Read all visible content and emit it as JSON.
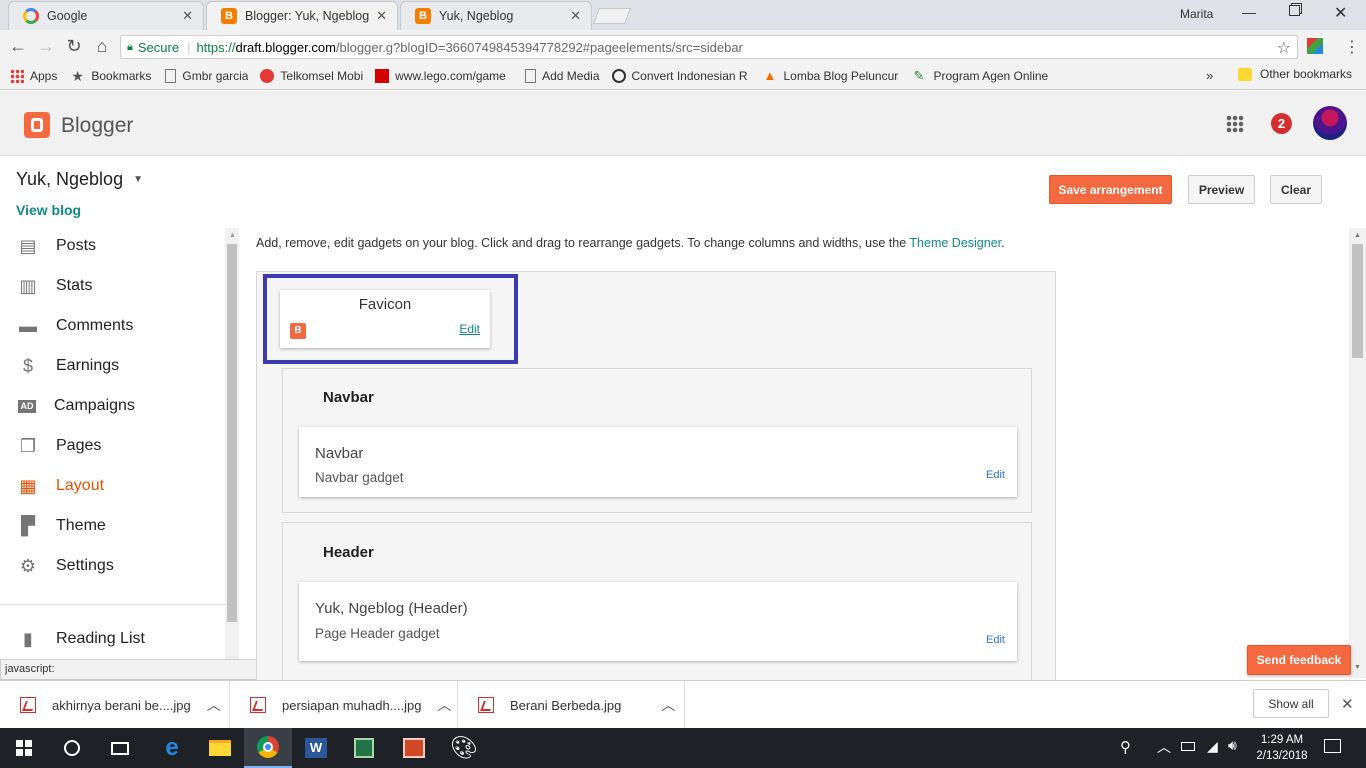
{
  "browser": {
    "tabs": [
      {
        "title": "Google",
        "icon": "google-icon"
      },
      {
        "title": "Blogger: Yuk, Ngeblog - l",
        "icon": "blogger-icon"
      },
      {
        "title": "Yuk, Ngeblog",
        "icon": "blogger-icon"
      }
    ],
    "user": "Marita",
    "secure_label": "Secure",
    "url_prefix": "https://",
    "url_domain": "draft.blogger.com",
    "url_path": "/blogger.g?blogID=3660749845394778292#pageelements/src=sidebar",
    "bookmarks": [
      "Apps",
      "Bookmarks",
      "Gmbr garcia",
      "Telkomsel Mobi",
      "www.lego.com/game",
      "Add Media",
      "Convert Indonesian R",
      "Lomba Blog Peluncur",
      "Program Agen Online"
    ],
    "bookmarks_overflow": "»",
    "other_bookmarks": "Other bookmarks",
    "status_text": "javascript:"
  },
  "blogger": {
    "logo_text": "Blogger",
    "notification_count": "2",
    "blog_name": "Yuk, Ngeblog",
    "view_blog": "View blog",
    "nav": [
      "Posts",
      "Stats",
      "Comments",
      "Earnings",
      "Campaigns",
      "Pages",
      "Layout",
      "Theme",
      "Settings"
    ],
    "reading_list": "Reading List",
    "buttons": {
      "save": "Save arrangement",
      "preview": "Preview",
      "clear": "Clear"
    },
    "instructions": "Add, remove, edit gadgets on your blog. Click and drag to rearrange gadgets. To change columns and widths, use the ",
    "theme_designer_link": "Theme Designer",
    "instructions_end": ".",
    "favicon": {
      "title": "Favicon",
      "edit": "Edit"
    },
    "sections": [
      {
        "title": "Navbar",
        "gadget_title": "Navbar",
        "gadget_sub": "Navbar gadget",
        "edit": "Edit"
      },
      {
        "title": "Header",
        "gadget_title": "Yuk, Ngeblog (Header)",
        "gadget_sub": "Page Header gadget",
        "edit": "Edit"
      }
    ],
    "send_feedback": "Send feedback"
  },
  "downloads": {
    "items": [
      "akhirnya berani be....jpg",
      "persiapan muhadh....jpg",
      "Berani Berbeda.jpg"
    ],
    "show_all": "Show all"
  },
  "taskbar": {
    "time": "1:29 AM",
    "date": "2/13/2018"
  },
  "colors": {
    "accent": "#f4693f",
    "layout_active": "#e65100",
    "link": "#0e8a8a",
    "highlight_border": "#3c3cb0"
  }
}
